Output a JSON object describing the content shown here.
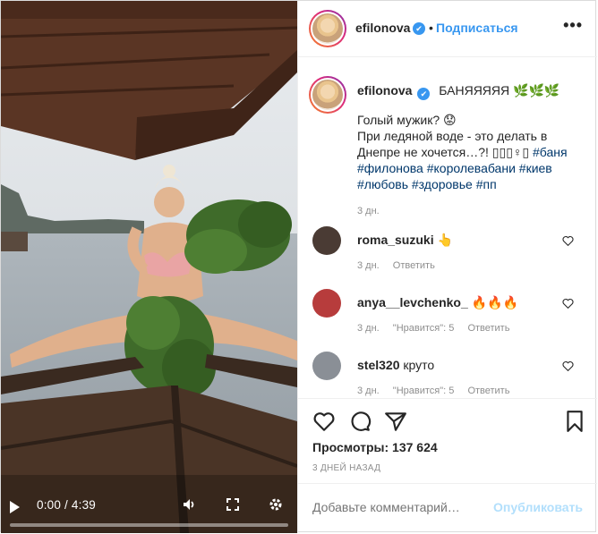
{
  "header": {
    "username": "efilonova",
    "verified_mark": "✔",
    "separator": "•",
    "follow_label": "Подписаться",
    "more_glyph": "•••"
  },
  "video": {
    "time": "0:00 / 4:39",
    "progress": 0,
    "icons": [
      "play-icon",
      "volume-icon",
      "fullscreen-icon",
      "settings-icon"
    ]
  },
  "caption": {
    "username": "efilonova",
    "verified_mark": "✔",
    "title": "БАНЯЯЯЯЯ 🌿🌿🌿",
    "line1": "Голый мужик? 😟",
    "line2": "При ледяной воде - это делать в",
    "line3_text": "Днепре не хочется…?! ",
    "line3_emoji": "▯▯▯♀▯ ",
    "line3_tag": "#баня",
    "tags_line4": "#филонова #королевабани #киев",
    "tags_line5": "#любовь #здоровье #пп",
    "date": "3 дн."
  },
  "comments": [
    {
      "username": "roma_suzuki",
      "text": "👆",
      "age": "3 дн.",
      "likes": "",
      "reply_label": "Ответить",
      "avatar_color": "#4a3b34"
    },
    {
      "username": "anya__levchenko_",
      "text": "🔥🔥🔥",
      "age": "3 дн.",
      "likes": "\"Нравится\": 5",
      "reply_label": "Ответить",
      "avatar_color": "#b73c3c"
    },
    {
      "username": "stel320",
      "text": "круто",
      "age": "3 дн.",
      "likes": "\"Нравится\": 5",
      "reply_label": "Ответить",
      "avatar_color": "#8a8f96"
    }
  ],
  "actions": {
    "icons": [
      "heart-icon",
      "comment-icon",
      "share-icon",
      "bookmark-icon"
    ],
    "views_label": "Просмотры: 137 624",
    "posted": "3 ДНЕЙ НАЗАД"
  },
  "add_comment": {
    "placeholder": "Добавьте комментарий…",
    "post_label": "Опубликовать"
  },
  "colors": {
    "accent": "#3897f0",
    "post_disabled": "#b2dffc",
    "muted": "#8e8e8e"
  }
}
